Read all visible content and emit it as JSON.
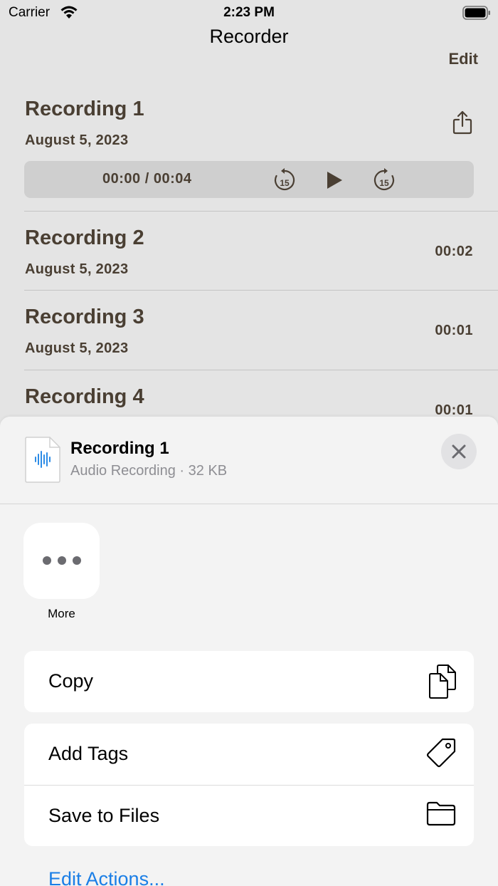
{
  "status_bar": {
    "carrier": "Carrier",
    "time": "2:23 PM"
  },
  "nav": {
    "title": "Recorder",
    "edit_label": "Edit"
  },
  "recordings": [
    {
      "title": "Recording 1",
      "date": "August 5, 2023",
      "duration": ""
    },
    {
      "title": "Recording 2",
      "date": "August 5, 2023",
      "duration": "00:02"
    },
    {
      "title": "Recording 3",
      "date": "August 5, 2023",
      "duration": "00:01"
    },
    {
      "title": "Recording 4",
      "date": "",
      "duration": "00:01"
    }
  ],
  "player": {
    "time": "00:00 / 00:04",
    "skip_seconds": "15",
    "progress": 0
  },
  "share_sheet": {
    "title": "Recording 1",
    "subtitle": "Audio Recording · 32 KB",
    "more_label": "More",
    "actions": [
      {
        "label": "Copy",
        "icon": "copy-icon"
      },
      {
        "label": "Add Tags",
        "icon": "tag-icon"
      },
      {
        "label": "Save to Files",
        "icon": "folder-icon"
      }
    ],
    "edit_actions_label": "Edit Actions..."
  },
  "colors": {
    "list_text": "#4a3f33",
    "background": "#e4e4e4",
    "sheet_background": "#f3f3f3",
    "link": "#1a7ee6",
    "waveform": "#2d8ce6"
  }
}
